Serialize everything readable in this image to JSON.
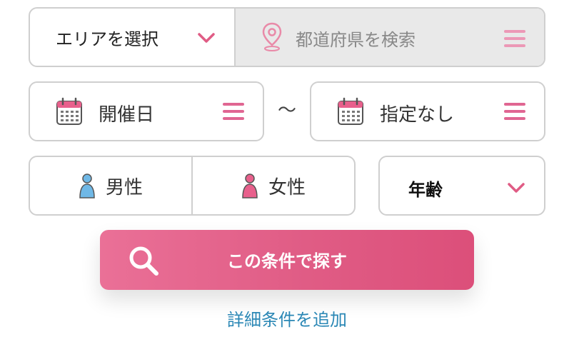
{
  "area": {
    "select_label": "エリアを選択",
    "prefecture_placeholder": "都道府県を検索"
  },
  "date": {
    "start_label": "開催日",
    "separator": "～",
    "end_label": "指定なし"
  },
  "gender": {
    "male_label": "男性",
    "female_label": "女性"
  },
  "age": {
    "label": "年齢"
  },
  "search": {
    "button_label": "この条件で探す"
  },
  "more": {
    "link_label": "詳細条件を追加"
  },
  "colors": {
    "accent_pink": "#e05c85",
    "male_blue": "#6fb8e6",
    "female_pink": "#e8608c",
    "link_blue": "#2a87b5"
  },
  "icons": [
    "chevron-down-icon",
    "map-pin-icon",
    "menu-icon",
    "calendar-icon",
    "person-icon",
    "search-icon"
  ]
}
